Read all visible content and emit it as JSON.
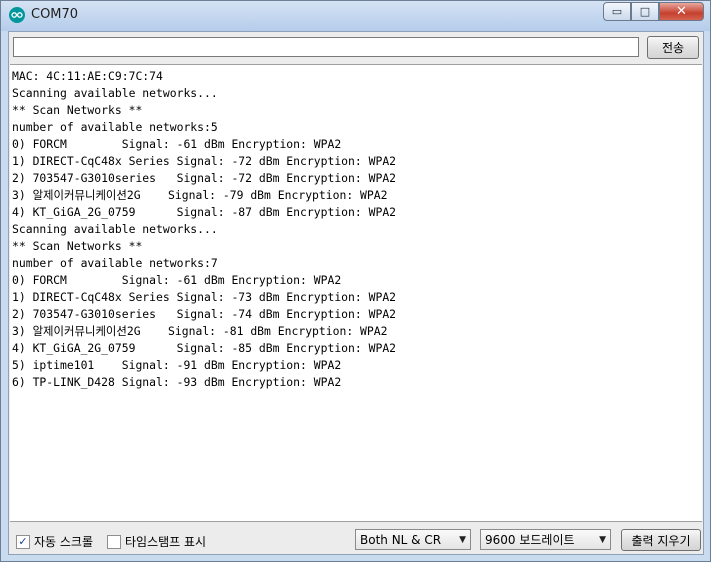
{
  "window": {
    "title": "COM70",
    "minimize_glyph": "▭",
    "maximize_glyph": "□",
    "close_glyph": "✕"
  },
  "send": {
    "input_value": "",
    "button_label": "전송"
  },
  "output_lines": [
    "MAC: 4C:11:AE:C9:7C:74",
    "Scanning available networks...",
    "** Scan Networks **",
    "number of available networks:5",
    "0) FORCM        Signal: -61 dBm Encryption: WPA2",
    "1) DIRECT-CqC48x Series Signal: -72 dBm Encryption: WPA2",
    "2) 703547-G3010series   Signal: -72 dBm Encryption: WPA2",
    "3) 알제이커뮤니케이션2G    Signal: -79 dBm Encryption: WPA2",
    "4) KT_GiGA_2G_0759      Signal: -87 dBm Encryption: WPA2",
    "Scanning available networks...",
    "** Scan Networks **",
    "number of available networks:7",
    "0) FORCM        Signal: -61 dBm Encryption: WPA2",
    "1) DIRECT-CqC48x Series Signal: -73 dBm Encryption: WPA2",
    "2) 703547-G3010series   Signal: -74 dBm Encryption: WPA2",
    "3) 알제이커뮤니케이션2G    Signal: -81 dBm Encryption: WPA2",
    "4) KT_GiGA_2G_0759      Signal: -85 dBm Encryption: WPA2",
    "5) iptime101    Signal: -91 dBm Encryption: WPA2",
    "6) TP-LINK_D428 Signal: -93 dBm Encryption: WPA2"
  ],
  "footer": {
    "autoscroll_label": "자동 스크롤",
    "autoscroll_checked": true,
    "autoscroll_mark": "✓",
    "timestamp_label": "타임스탬프 표시",
    "timestamp_checked": false,
    "line_ending": "Both NL & CR",
    "baud_rate": "9600 보드레이트",
    "dropdown_glyph": "▼",
    "clear_label": "출력 지우기"
  }
}
